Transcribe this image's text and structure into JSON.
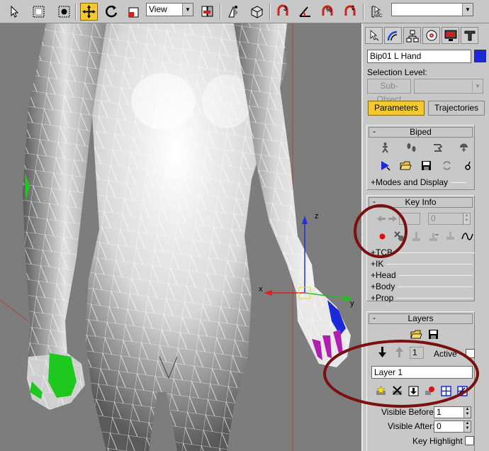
{
  "toolbar": {
    "view_dropdown": "View",
    "named_selection": "",
    "buttons": [
      "select-icon",
      "region-select-icon",
      "window-crossing-icon",
      "move-icon",
      "rotate-icon",
      "scale-icon",
      "use-center-icon",
      "mirror-icon",
      "align-icon",
      "snaps-3d-icon",
      "angle-snap-icon",
      "percent-snap-icon",
      "spinner-snap-icon",
      "edit-named-selection-icon"
    ]
  },
  "panel": {
    "tabs": [
      "create-icon",
      "modify-icon",
      "hierarchy-icon",
      "motion-icon",
      "display-icon",
      "utilities-icon"
    ],
    "object_name": "Bip01 L Hand",
    "object_color": "#1a2ad8",
    "selection_level_label": "Selection Level:",
    "subobject_button": "Sub-Object",
    "parameters_button": "Parameters",
    "trajectories_button": "Trajectories"
  },
  "biped": {
    "title": "Biped",
    "collapse": "-",
    "row1": [
      "figure-mode-icon",
      "footstep-mode-icon",
      "motion-flow-icon",
      "mixer-mode-icon"
    ],
    "row2": [
      "playback-icon",
      "load-file-icon",
      "save-file-icon",
      "convert-icon",
      "move-all-icon"
    ],
    "modes_link": "+Modes and Display"
  },
  "keyinfo": {
    "title": "Key Info",
    "collapse": "-",
    "key_number": "",
    "key_value": "0",
    "row_icons": [
      "set-key-icon",
      "delete-key-icon",
      "set-planted-icon",
      "set-sliding-icon",
      "set-free-icon",
      "trajectory-curve-icon"
    ],
    "links": [
      "+TCB",
      "+IK",
      "+Head",
      "+Body",
      "+Prop"
    ]
  },
  "layers": {
    "title": "Layers",
    "collapse": "-",
    "layer_number": "1",
    "active_label": "Active",
    "layer_name": "Layer 1",
    "icon_row": [
      "create-layer-icon",
      "delete-layer-icon",
      "collapse-layer-icon",
      "snap-set-key-icon",
      "retarget-icon",
      "retarget-body-icon"
    ],
    "visible_before_label": "Visible Before:",
    "visible_before": "1",
    "visible_after_label": "Visible After:",
    "visible_after": "0",
    "key_highlight_label": "Key Highlight"
  },
  "annotation_color": "#7a1010"
}
